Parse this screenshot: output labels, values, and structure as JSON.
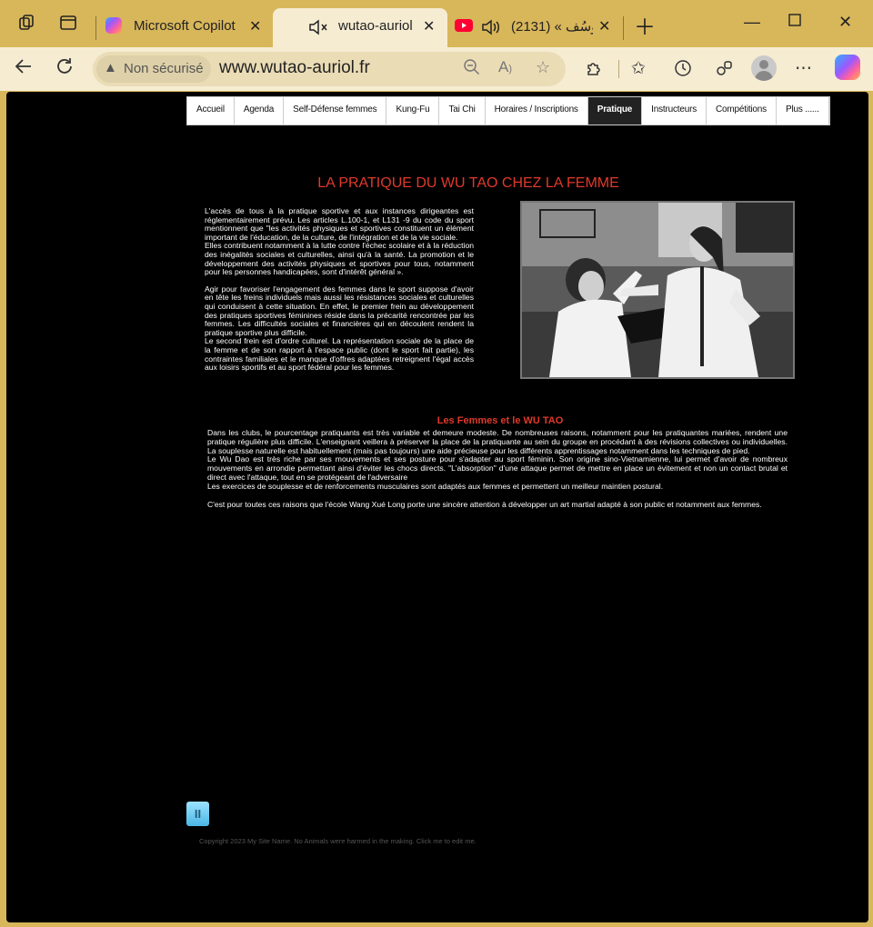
{
  "browser": {
    "tabs": [
      {
        "label": "Microsoft Copilot"
      },
      {
        "label": "wutao-auriol"
      },
      {
        "label": "يُوسُف » (2131)"
      }
    ],
    "address": {
      "security_label": "Non sécurisé",
      "url": "www.wutao-auriol.fr"
    }
  },
  "site": {
    "menu": [
      {
        "label": "Accueil"
      },
      {
        "label": "Agenda"
      },
      {
        "label": "Self-Défense femmes"
      },
      {
        "label": "Kung-Fu"
      },
      {
        "label": "Tai Chi"
      },
      {
        "label": "Horaires / Inscriptions"
      },
      {
        "label": "Pratique"
      },
      {
        "label": "Instructeurs"
      },
      {
        "label": "Compétitions"
      },
      {
        "label": "Plus ......"
      }
    ],
    "title": "LA PRATIQUE DU WU TAO CHEZ LA FEMME",
    "intro": {
      "p1": "L'accès de tous à la pratique sportive et aux instances dirigeantes est réglementairement prévu. Les articles L.100-1, et L131 -9 du code du sport mentionnent que \"les activités physiques et sportives constituent un élément important de l'éducation, de la culture, de l'intégration et de la vie sociale.",
      "p2": "Elles contribuent notamment à la lutte contre l'échec scolaire et à la réduction des inégalités sociales et culturelles, ainsi qu'à la santé. La promotion et le développement des activités physiques et sportives pour tous, notamment pour les personnes handicapées, sont d'intérêt général ».",
      "p3": "Agir pour favoriser l'engagement des femmes dans le sport suppose d'avoir en tête les freins individuels mais aussi les résistances sociales et culturelles qui conduisent à cette situation. En effet, le premier frein au développement des pratiques sportives féminines réside dans la précarité rencontrée par les femmes. Les difficultés sociales et financières qui en découlent rendent la pratique sportive plus difficile.",
      "p4": "Le second frein est d'ordre culturel. La représentation sociale de la place de la femme et de son rapport à l'espace public (dont le sport fait partie), les contraintes familiales et le manque d'offres adaptées retreignent l'égal accès aux loisirs sportifs et au sport fédéral pour les femmes."
    },
    "subtitle": "Les Femmes et le WU TAO",
    "body": {
      "p1": "Dans les clubs, le pourcentage  pratiquants est très variable et demeure modeste. De nombreuses raisons, notamment pour les pratiquantes mariées, rendent une pratique régulière plus difficile. L'enseignant veillera à préserver la place de la pratiquante au sein du groupe en procédant à des révisions collectives ou individuelles. La souplesse naturelle est habituellement (mais pas toujours) une aide précieuse pour les  différents apprentissages notamment dans les techniques de pied.",
      "p2": "Le Wu Dao est très riche par ses mouvements et ses posture pour s'adapter au sport féminin. Son origine sino-Vietnamienne, lui permet d'avoir de nombreux mouvements en arrondie permettant ainsi d'éviter les chocs directs. \"L'absorption\" d'une attaque permet de mettre en place un évitement et non un contact brutal et direct avec l'attaque, tout en se protégeant de l'adversaire",
      "p3": "Les exercices de souplesse et de renforcements musculaires sont adaptés aux femmes et permettent un meilleur maintien postural.",
      "p4": "C'est pour toutes ces raisons que l'école Wang Xué Long porte une sincère attention à développer un art martial adapté à son public et notamment aux femmes."
    },
    "pause_label": "II",
    "footer": "Copyright 2023 My Site Name. No Animals were harmed in the making. Click me to edit me."
  },
  "colors": {
    "accent": "#e0392b",
    "page_bg": "#000000",
    "chrome": "#d8b65a"
  }
}
